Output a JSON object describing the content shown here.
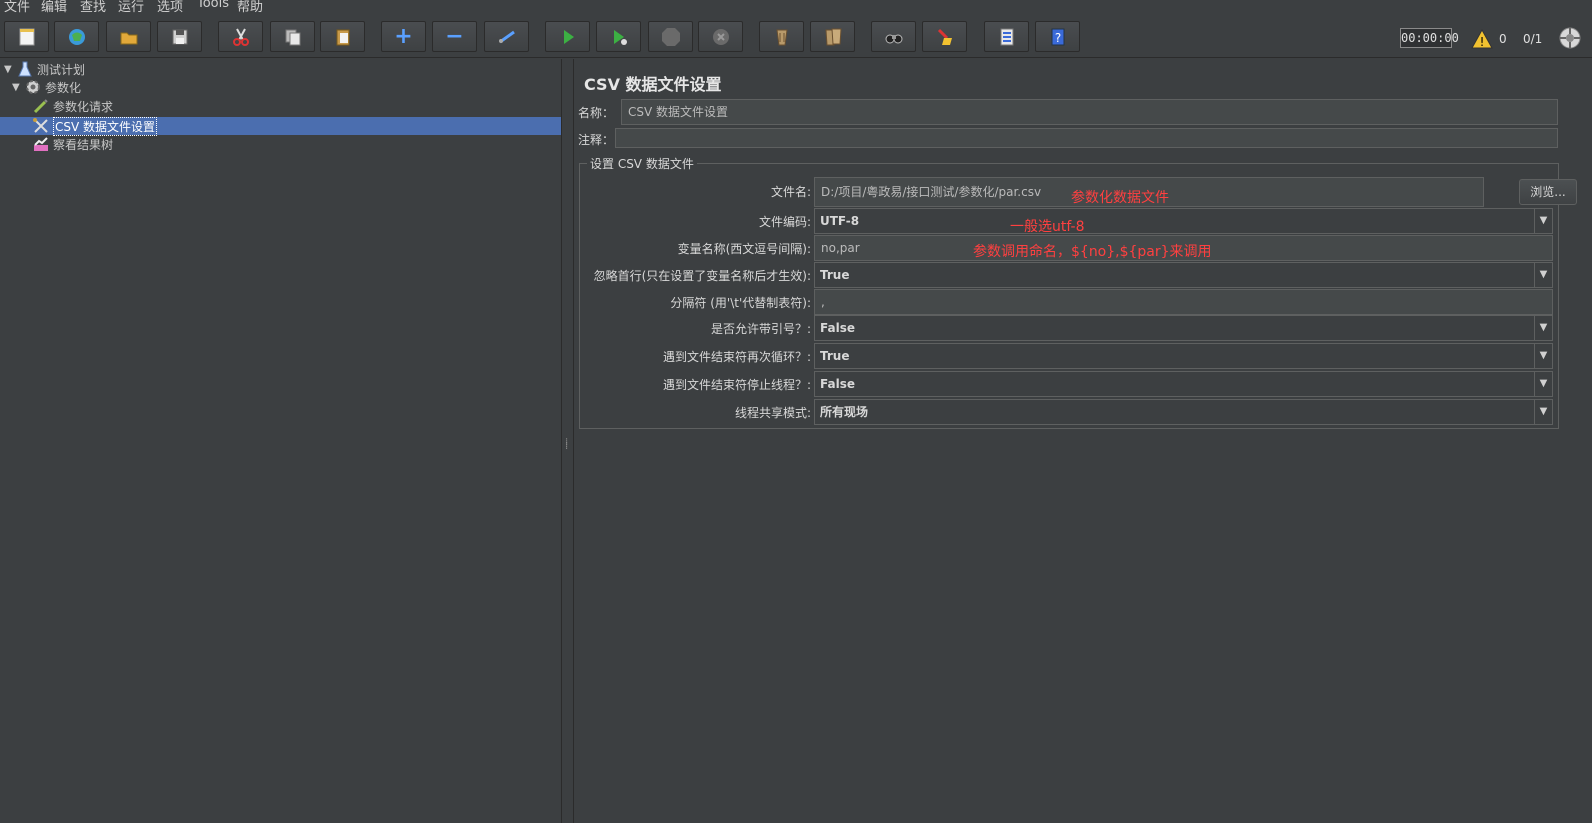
{
  "menubar": {
    "items": [
      {
        "label": "文件"
      },
      {
        "label": "编辑"
      },
      {
        "label": "查找"
      },
      {
        "label": "运行"
      },
      {
        "label": "选项"
      },
      {
        "label": "Tools"
      },
      {
        "label": "帮助"
      }
    ]
  },
  "toolbar": {
    "buttons": [
      {
        "icon": "new-file-icon"
      },
      {
        "icon": "templates-icon"
      },
      {
        "icon": "open-icon"
      },
      {
        "icon": "save-icon"
      },
      {
        "icon": "cut-icon"
      },
      {
        "icon": "copy-icon"
      },
      {
        "icon": "paste-icon"
      },
      {
        "icon": "expand-icon"
      },
      {
        "icon": "collapse-icon"
      },
      {
        "icon": "toggle-icon"
      },
      {
        "icon": "start-icon"
      },
      {
        "icon": "start-no-pause-icon"
      },
      {
        "icon": "stop-icon"
      },
      {
        "icon": "shutdown-icon"
      },
      {
        "icon": "clear-icon"
      },
      {
        "icon": "clear-all-icon"
      },
      {
        "icon": "search-icon"
      },
      {
        "icon": "reset-search-icon"
      },
      {
        "icon": "function-helper-icon"
      },
      {
        "icon": "help-icon"
      }
    ],
    "timer": "00:00:00",
    "warning_count": "0",
    "threads": "0/1"
  },
  "tree": {
    "nodes": [
      {
        "label": "测试计划",
        "icon": "test-plan-icon",
        "expanded": true
      },
      {
        "label": "参数化",
        "icon": "thread-group-icon",
        "expanded": true
      },
      {
        "label": "参数化请求",
        "icon": "sampler-icon"
      },
      {
        "label": "CSV 数据文件设置",
        "icon": "csv-config-icon",
        "selected": true
      },
      {
        "label": "察看结果树",
        "icon": "listener-icon"
      }
    ]
  },
  "panel": {
    "title": "CSV 数据文件设置",
    "name_label": "名称：",
    "name_value": "CSV 数据文件设置",
    "comment_label": "注释：",
    "comment_value": "",
    "group_title": "设置 CSV 数据文件",
    "browse_label": "浏览...",
    "fields": [
      {
        "label": "文件名:",
        "value": "D:/项目/粤政易/接口测试/参数化/par.csv",
        "type": "text"
      },
      {
        "label": "文件编码:",
        "value": "UTF-8",
        "type": "combo"
      },
      {
        "label": "变量名称(西文逗号间隔):",
        "value": "no,par",
        "type": "text"
      },
      {
        "label": "忽略首行(只在设置了变量名称后才生效):",
        "value": "True",
        "type": "combo"
      },
      {
        "label": "分隔符 (用'\\t'代替制表符):",
        "value": ",",
        "type": "text"
      },
      {
        "label": "是否允许带引号？:",
        "value": "False",
        "type": "combo"
      },
      {
        "label": "遇到文件结束符再次循环？:",
        "value": "True",
        "type": "combo"
      },
      {
        "label": "遇到文件结束符停止线程？:",
        "value": "False",
        "type": "combo"
      },
      {
        "label": "线程共享模式:",
        "value": "所有现场",
        "type": "combo"
      }
    ]
  },
  "annotations": [
    {
      "text": "参数化数据文件",
      "color": "#ff4040"
    },
    {
      "text": "一般选utf-8",
      "color": "#ff4040"
    },
    {
      "text": "参数调用命名，${no},${par}来调用",
      "color": "#ff4040"
    }
  ],
  "colors": {
    "background": "#3c3f41",
    "selection": "#4b6eaf",
    "annotation": "#ff4040"
  }
}
